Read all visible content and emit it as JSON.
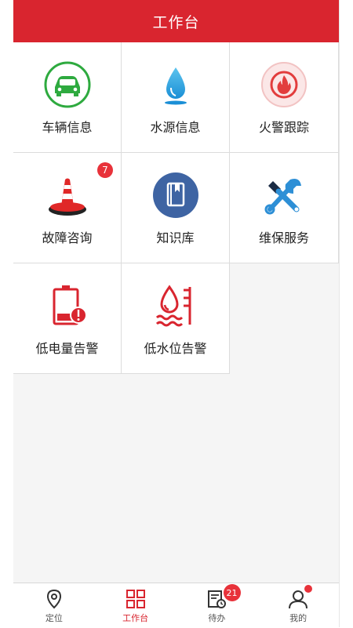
{
  "header": {
    "title": "工作台"
  },
  "grid": {
    "items": [
      {
        "label": "车辆信息",
        "icon": "car-icon"
      },
      {
        "label": "水源信息",
        "icon": "water-drop-icon"
      },
      {
        "label": "火警跟踪",
        "icon": "fire-alarm-icon"
      },
      {
        "label": "故障咨询",
        "icon": "traffic-cone-icon",
        "badge": "7"
      },
      {
        "label": "知识库",
        "icon": "book-icon"
      },
      {
        "label": "维保服务",
        "icon": "tools-icon"
      },
      {
        "label": "低电量告警",
        "icon": "low-battery-icon"
      },
      {
        "label": "低水位告警",
        "icon": "low-water-level-icon"
      }
    ]
  },
  "nav": {
    "items": [
      {
        "label": "定位",
        "icon": "location-pin-icon"
      },
      {
        "label": "工作台",
        "icon": "grid-icon",
        "active": true
      },
      {
        "label": "待办",
        "icon": "todo-icon",
        "badge": "21"
      },
      {
        "label": "我的",
        "icon": "user-icon",
        "dot": true
      }
    ]
  },
  "colors": {
    "brand": "#d9252f",
    "badge": "#e8323a"
  }
}
